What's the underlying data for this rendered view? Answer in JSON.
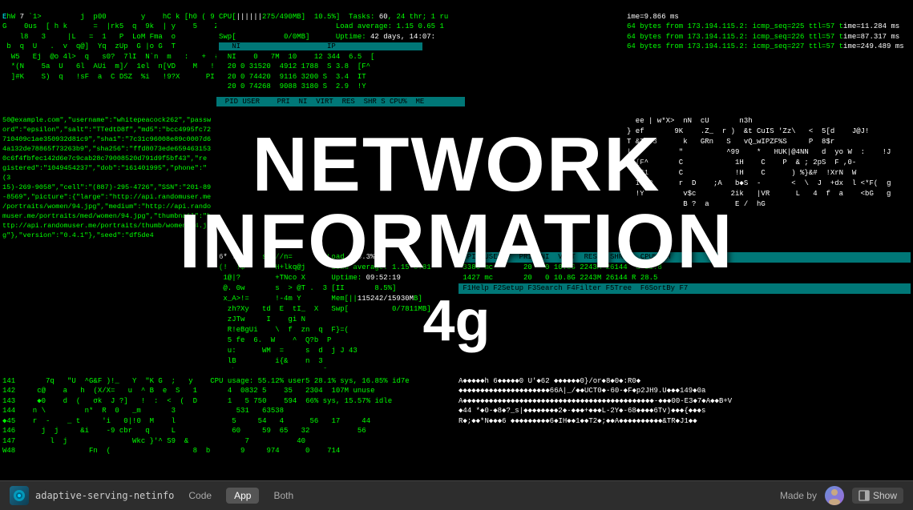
{
  "background": {
    "color": "#000000"
  },
  "overlay": {
    "line1": "NETWORK",
    "line2": "INFORMATION",
    "subtitle": "4g"
  },
  "toolbar": {
    "app_name": "adaptive-serving-netinfo",
    "tabs": [
      {
        "id": "code",
        "label": "Code",
        "active": false
      },
      {
        "id": "app",
        "label": "App",
        "active": true
      },
      {
        "id": "both",
        "label": "Both",
        "active": false
      }
    ],
    "made_by_label": "Made by",
    "show_label": "Show"
  },
  "terminal": {
    "color_green": "#00ff00",
    "color_cyan": "#00ffff"
  }
}
